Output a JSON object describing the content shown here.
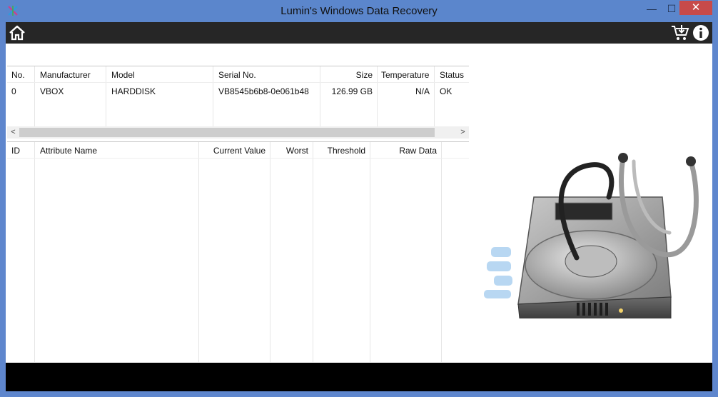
{
  "window": {
    "title": "Lumin's Windows Data Recovery",
    "min_glyph": "—",
    "max_glyph": "☐",
    "close_glyph": "✕"
  },
  "toolbar": {
    "icons": [
      "home-icon",
      "cart-icon",
      "info-icon"
    ]
  },
  "drives_table": {
    "columns": [
      "No.",
      "Manufacturer",
      "Model",
      "Serial No.",
      "Size",
      "Temperature",
      "Status"
    ],
    "rows": [
      [
        "0",
        "VBOX",
        "HARDDISK",
        "VB8545b6b8-0e061b48",
        "126.99 GB",
        "N/A",
        "OK"
      ]
    ]
  },
  "attributes_table": {
    "columns": [
      "ID",
      "Attribute Name",
      "Current Value",
      "Worst",
      "Threshold",
      "Raw Data"
    ],
    "rows": []
  },
  "scrollbar": {
    "left_glyph": "<",
    "right_glyph": ">"
  },
  "colors": {
    "titlebar": "#5b86cc",
    "toolbar": "#262626",
    "close": "#c74a4a",
    "footer": "#000000"
  }
}
